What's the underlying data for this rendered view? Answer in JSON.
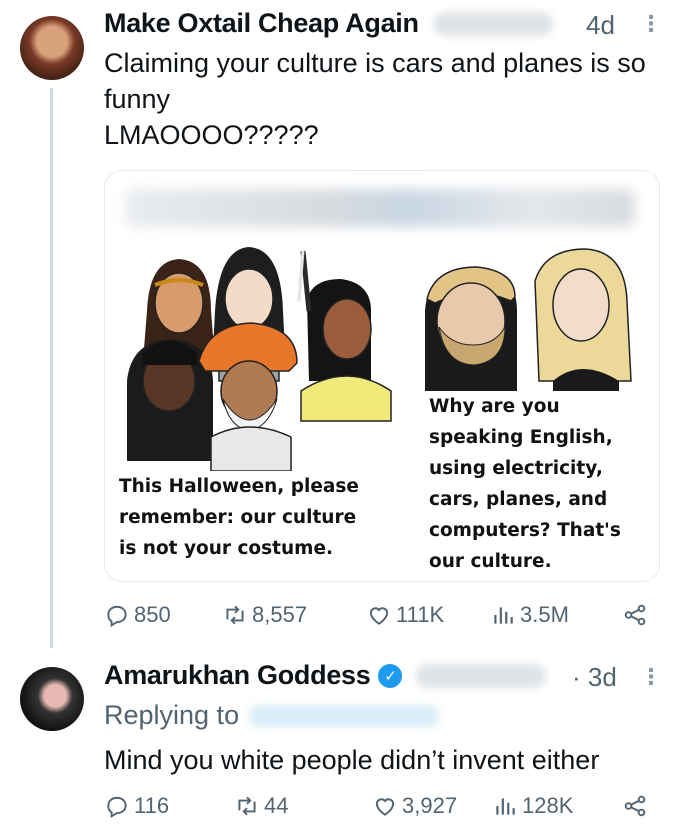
{
  "tweets": [
    {
      "name": "Make Oxtail Cheap Again",
      "time": "4d",
      "text": "Claiming your culture is cars and planes is so funny\nLMAOOOO?????",
      "quote": {
        "left_caption": "This Halloween, please\nremember: our culture\nis not your costume.",
        "right_caption": "Why are you\nspeaking English,\nusing electricity,\ncars, planes, and\ncomputers? That's\nour culture."
      },
      "actions": {
        "replies": "850",
        "reposts": "8,557",
        "likes": "111K",
        "views": "3.5M"
      }
    },
    {
      "name": "Amarukhan Goddess",
      "time": "· 3d",
      "replying_to": "Replying to",
      "text": "Mind you white people didn’t invent either",
      "actions": {
        "replies": "116",
        "reposts": "44",
        "likes": "3,927",
        "views": "128K"
      }
    }
  ],
  "colors": {
    "accent": "#1d9bf0",
    "secondary_text": "#536471",
    "border": "#cfd9de"
  },
  "icons": [
    "reply-icon",
    "repost-icon",
    "like-icon",
    "views-icon",
    "share-icon",
    "verified-icon",
    "more-icon"
  ]
}
